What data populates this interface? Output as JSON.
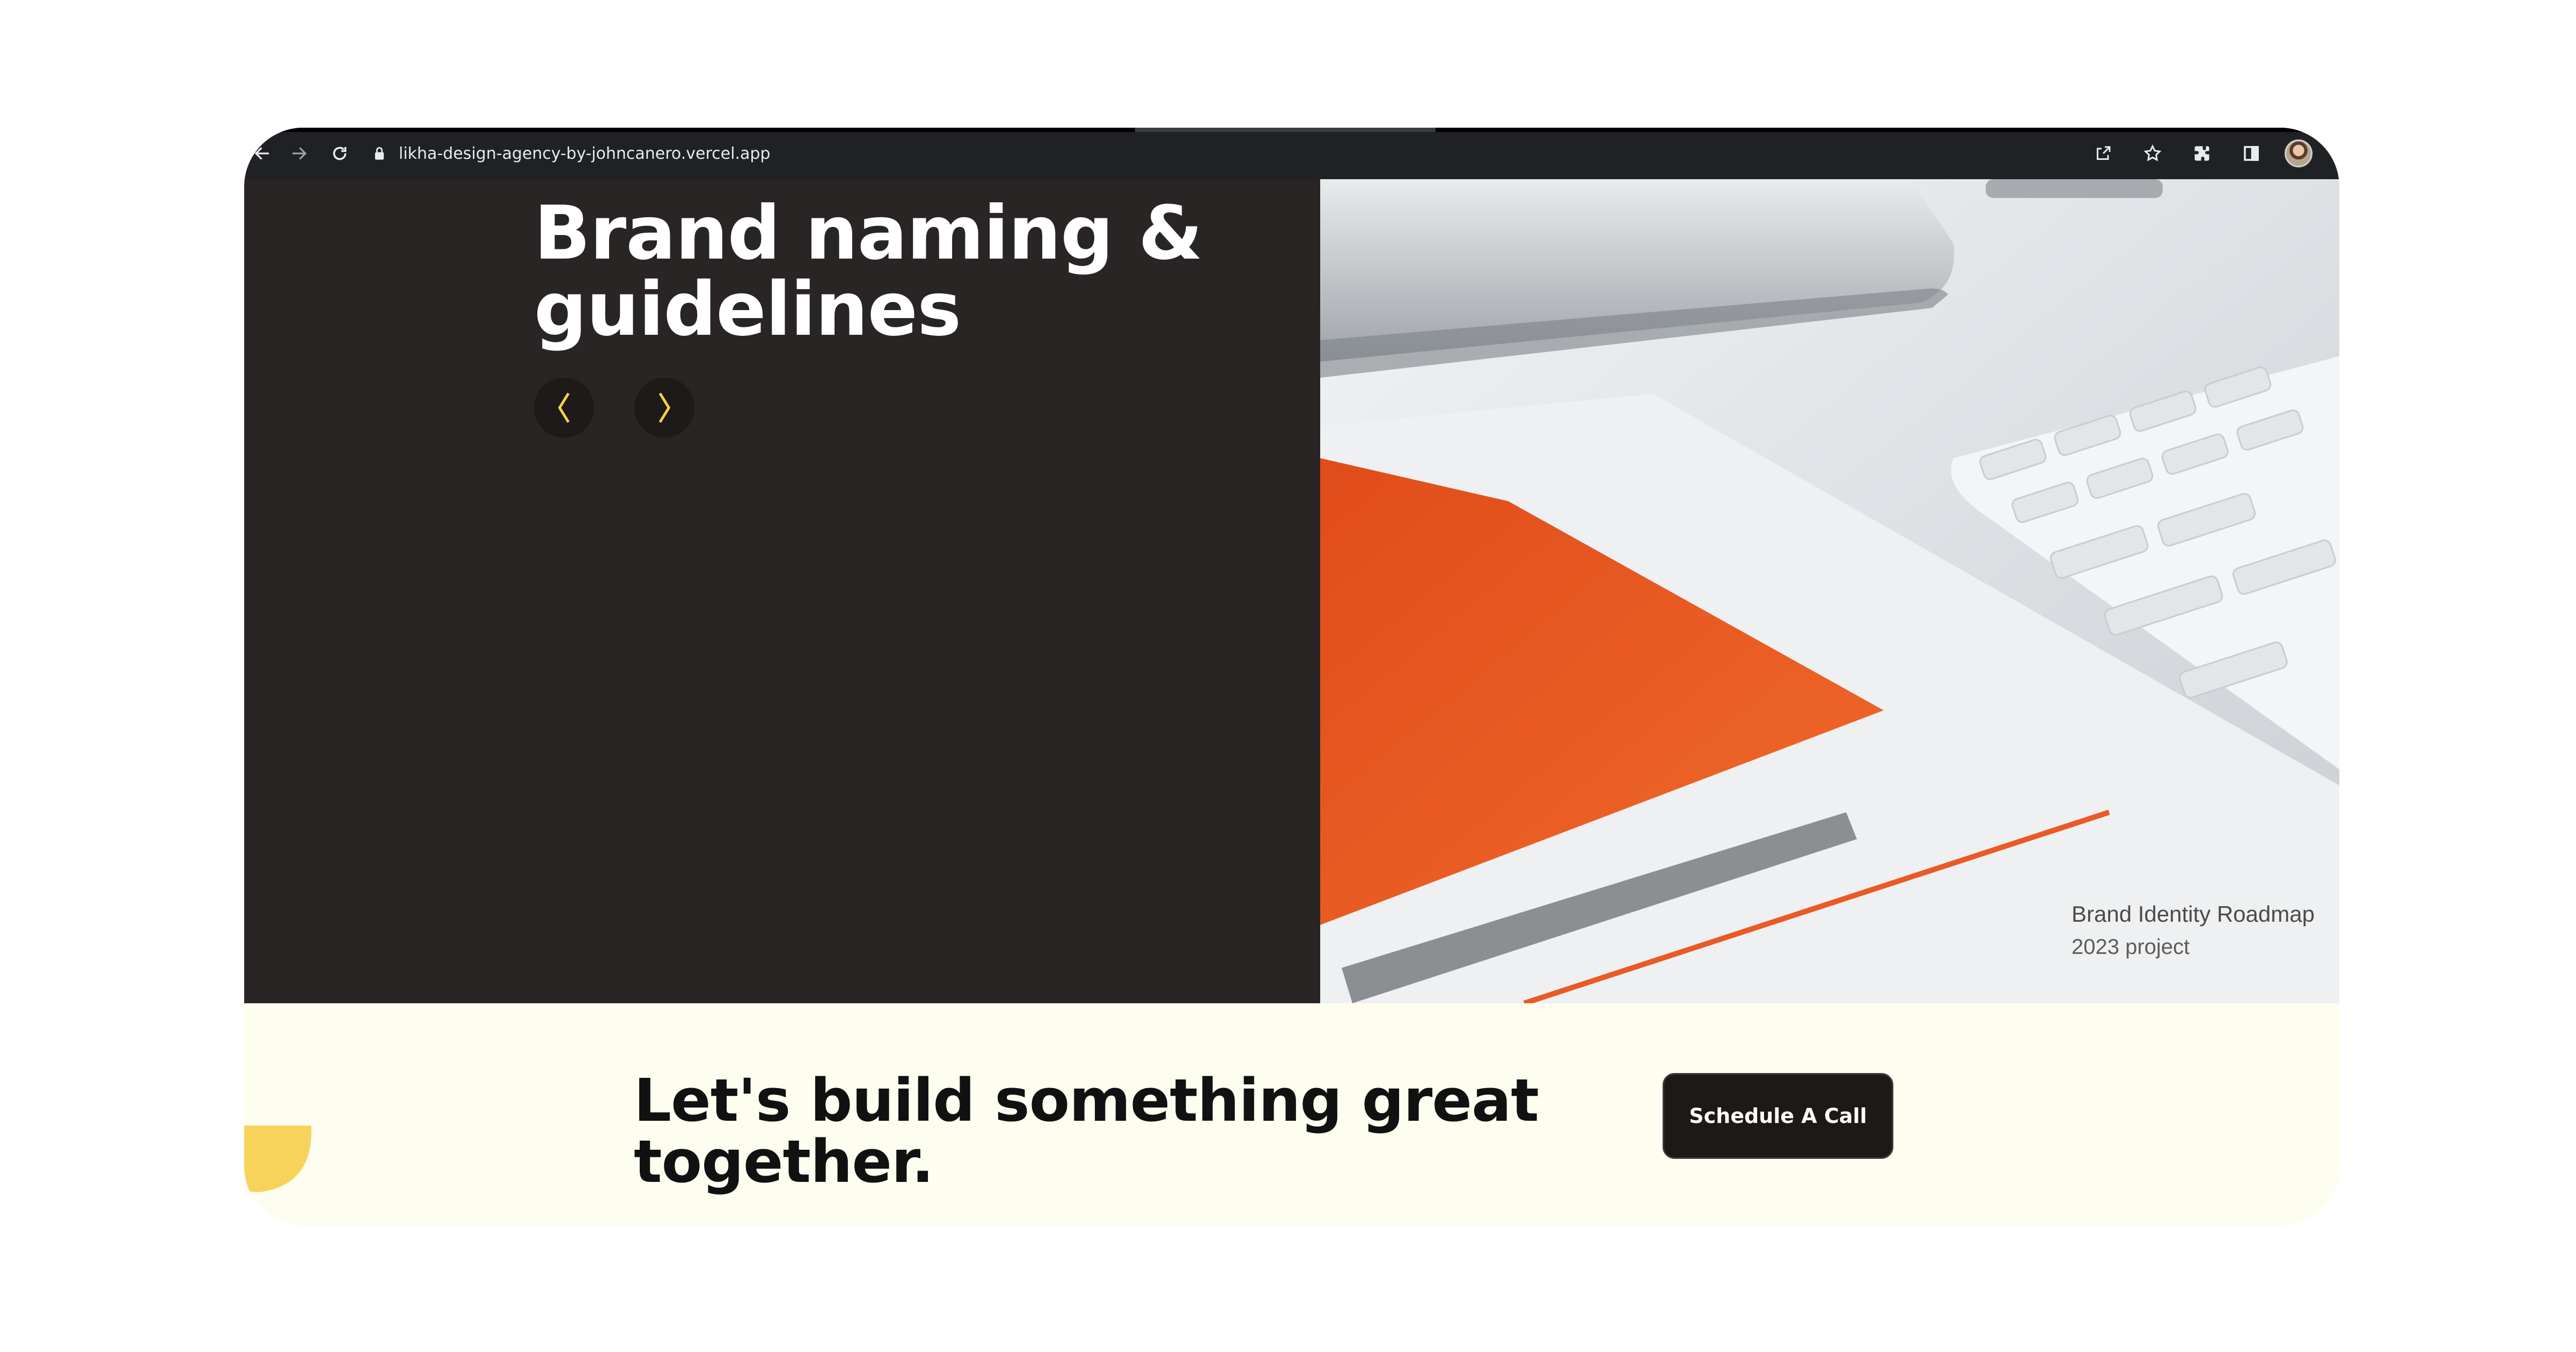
{
  "browser": {
    "url": "likha-design-agency-by-johncanero.vercel.app",
    "icons": [
      "back-arrow-icon",
      "forward-arrow-icon",
      "reload-icon",
      "lock-icon",
      "share-icon",
      "star-icon",
      "extensions-icon",
      "side-panel-icon",
      "profile-avatar"
    ]
  },
  "hero": {
    "title": "Brand naming & guidelines",
    "prev_icon": "chevron-left-icon",
    "next_icon": "chevron-right-icon",
    "arrow_color": "#f5cf48",
    "project": {
      "name": "Brand Identity Roadmap",
      "year": "2023 project"
    }
  },
  "cta": {
    "title": "Let's build something great together.",
    "button_label": "Schedule A Call",
    "accent_color": "#f7d35c"
  },
  "colors": {
    "hero_bg": "#292524",
    "cta_bg": "#fdfdf0",
    "button_bg": "#1c1917"
  }
}
